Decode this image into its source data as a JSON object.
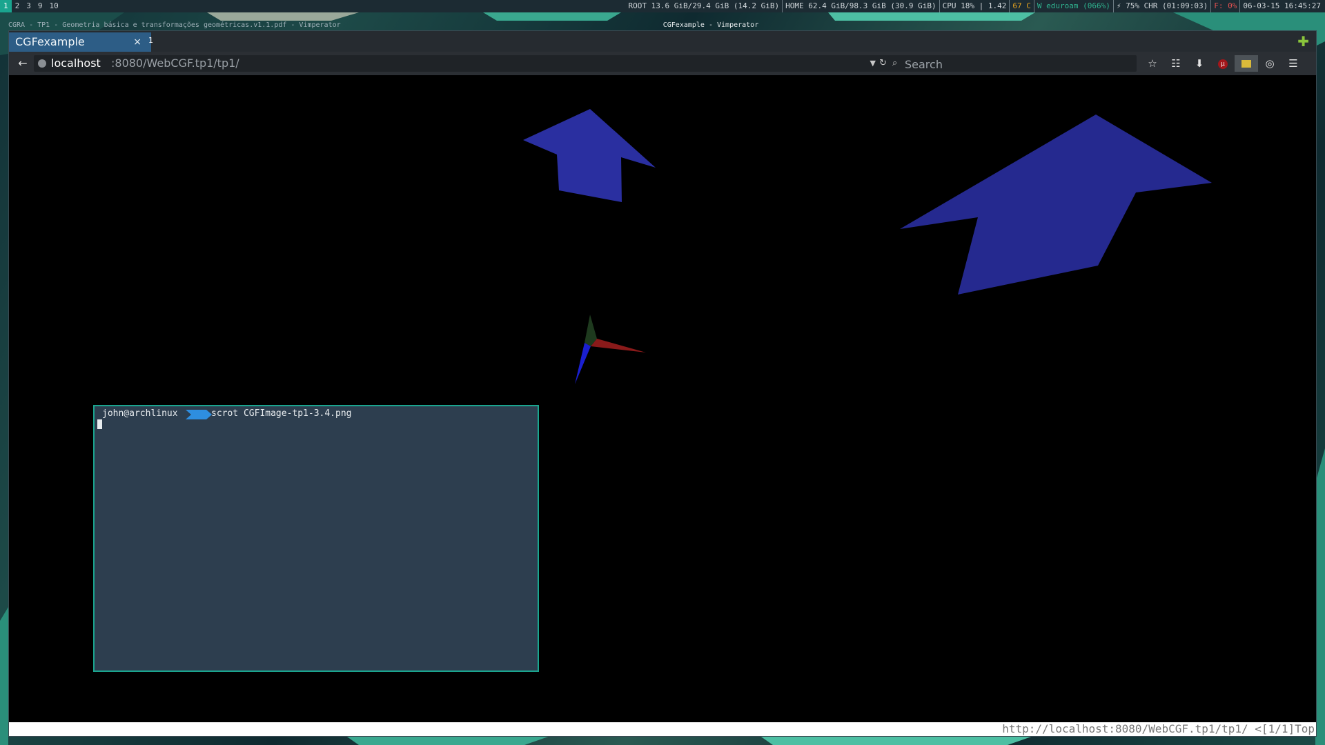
{
  "desktop": {
    "workspaces": [
      "1",
      "2",
      "3",
      "9",
      "10"
    ],
    "active_workspace": "1",
    "status": [
      "ROOT 13.6 GiB/29.4 GiB (14.2 GiB)",
      "HOME 62.4 GiB/98.3 GiB (30.9 GiB)",
      "CPU 18% | 1.42",
      "67 C",
      "W eduroam (066%)",
      "⚡ 75% CHR (01:09:03)",
      "F: 0%",
      "06-03-15 16:45:27"
    ],
    "left_window_title": "CGRA - TP1 - Geometria básica e transformações geométricas.v1.1.pdf - Vimperator",
    "focused_window_title": "CGFexample - Vimperator",
    "accent_color": "#1aa58f"
  },
  "browser": {
    "tab": {
      "title": "CGFexample",
      "close": "×",
      "number": "1"
    },
    "new_tab": "✚",
    "url": {
      "host": "localhost",
      "rest": ":8080/WebCGF.tp1/tp1/"
    },
    "search": {
      "placeholder": "Search",
      "value": ""
    },
    "toolbar_icons": [
      "star-icon",
      "clipboard-icon",
      "download-icon",
      "ublock-icon",
      "notes-icon",
      "privacy-icon",
      "menu-icon"
    ],
    "status_line": "http://localhost:8080/WebCGF.tp1/tp1/ <[1/1]Top"
  },
  "terminal": {
    "user": "john@archlinux",
    "command": "scrot CGFImage-tp1-3.4.png"
  },
  "scene": {
    "shape_color": "#2a2fa0",
    "axis_colors": {
      "x": "#8a1a1a",
      "y": "#1e3a1e",
      "z": "#1a1fd0"
    }
  }
}
